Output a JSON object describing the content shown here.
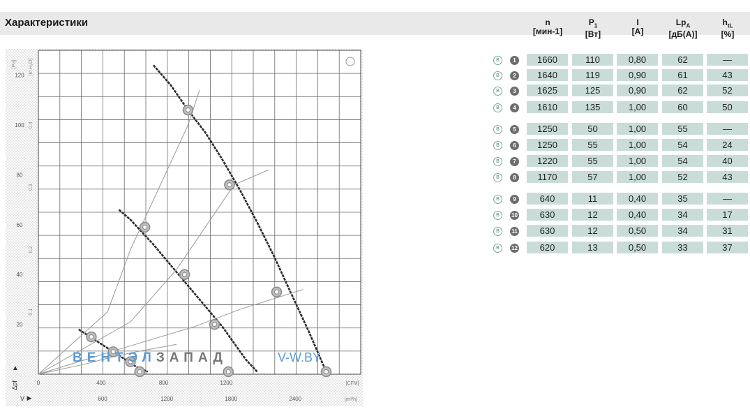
{
  "section": {
    "title": "Характеристики"
  },
  "table": {
    "headers": [
      {
        "name": "n",
        "sub": "",
        "unit": "[мин-1]"
      },
      {
        "name": "P",
        "sub": "1",
        "unit": "[Вт]"
      },
      {
        "name": "I",
        "sub": "",
        "unit": "[A]"
      },
      {
        "name": "Lp",
        "sub": "A",
        "unit": "[дБ(A)]"
      },
      {
        "name": "h",
        "sub": "tL",
        "unit": "[%]"
      }
    ],
    "row_marker": "B",
    "rows": [
      {
        "id": "1",
        "n": "1660",
        "p1": "110",
        "i": "0,80",
        "lpa": "62",
        "htl": "—"
      },
      {
        "id": "2",
        "n": "1640",
        "p1": "119",
        "i": "0,90",
        "lpa": "61",
        "htl": "43"
      },
      {
        "id": "3",
        "n": "1625",
        "p1": "125",
        "i": "0,90",
        "lpa": "62",
        "htl": "52"
      },
      {
        "id": "4",
        "n": "1610",
        "p1": "135",
        "i": "1,00",
        "lpa": "60",
        "htl": "50"
      },
      {
        "id": "5",
        "n": "1250",
        "p1": "50",
        "i": "1,00",
        "lpa": "55",
        "htl": "—"
      },
      {
        "id": "6",
        "n": "1250",
        "p1": "55",
        "i": "1,00",
        "lpa": "54",
        "htl": "24"
      },
      {
        "id": "7",
        "n": "1220",
        "p1": "55",
        "i": "1,00",
        "lpa": "54",
        "htl": "40"
      },
      {
        "id": "8",
        "n": "1170",
        "p1": "57",
        "i": "1,00",
        "lpa": "52",
        "htl": "43"
      },
      {
        "id": "9",
        "n": "640",
        "p1": "11",
        "i": "0,40",
        "lpa": "35",
        "htl": "—"
      },
      {
        "id": "10",
        "n": "630",
        "p1": "12",
        "i": "0,40",
        "lpa": "34",
        "htl": "17"
      },
      {
        "id": "11",
        "n": "630",
        "p1": "12",
        "i": "0,50",
        "lpa": "34",
        "htl": "31"
      },
      {
        "id": "12",
        "n": "620",
        "p1": "13",
        "i": "0,50",
        "lpa": "33",
        "htl": "37"
      }
    ]
  },
  "watermark": {
    "part1": "ВЕНТЭЛ",
    "part2": "ЗАПАД",
    "part3": "V-W.BY"
  },
  "colors": {
    "cell_bg": "#c9dcd8",
    "curve": "#2b2b2b",
    "marker": "#a9a9a9",
    "watermark_blue": "#5b9bd5",
    "watermark_gray": "#777777",
    "chart_bg": "#e6e6e6"
  },
  "chart_data": {
    "type": "line",
    "xlabel": "[CFM]",
    "x2label": "[m³/h]",
    "ylabel": "[in H₂O]",
    "y2label": "[Pa]",
    "xlim": [
      0,
      2800
    ],
    "ylim": [
      0,
      130
    ],
    "x_ticks": [
      "0",
      "400",
      "800",
      "1200",
      "2400"
    ],
    "x2_ticks": [
      "600",
      "1200",
      "1800",
      "2400"
    ],
    "y_ticks": [
      "20",
      "40",
      "60",
      "80",
      "100",
      "120"
    ],
    "y2_ticks": [
      "0.1",
      "0.2",
      "0.3",
      "0.4"
    ],
    "grid": true,
    "series": [
      {
        "name": "",
        "style": "thick",
        "x": [
          1000,
          1150,
          1300,
          1450,
          1600,
          1750,
          1900,
          2050,
          2200,
          2350,
          2500
        ],
        "y": [
          124,
          116,
          106,
          97,
          86,
          74,
          61,
          47,
          32,
          17,
          1
        ]
      },
      {
        "name": "",
        "style": "thick",
        "x": [
          700,
          800,
          1000,
          1200,
          1400,
          1600,
          1800,
          1900
        ],
        "y": [
          66,
          62,
          52,
          41,
          30,
          19,
          6,
          1
        ]
      },
      {
        "name": "",
        "style": "thick",
        "x": [
          350,
          450,
          550,
          650,
          750,
          850,
          950
        ],
        "y": [
          18,
          15,
          12,
          9,
          6,
          3,
          1
        ]
      },
      {
        "name": "",
        "style": "thin",
        "x": [
          0,
          600,
          800,
          1300,
          1400
        ],
        "y": [
          0,
          25,
          50,
          100,
          114
        ]
      },
      {
        "name": "",
        "style": "thin",
        "x": [
          0,
          800,
          1200,
          1700,
          2000
        ],
        "y": [
          0,
          21,
          42,
          76,
          82
        ]
      },
      {
        "name": "",
        "style": "thin",
        "x": [
          0,
          700,
          1350,
          1750,
          2300
        ],
        "y": [
          0,
          10,
          19,
          26,
          34
        ]
      },
      {
        "name": "",
        "style": "thin",
        "x": [
          0,
          400,
          650,
          850,
          1200
        ],
        "y": [
          0,
          4,
          7,
          9,
          12
        ]
      }
    ],
    "points": [
      {
        "x": 1300,
        "y": 106
      },
      {
        "x": 1660,
        "y": 76
      },
      {
        "x": 2070,
        "y": 33
      },
      {
        "x": 2500,
        "y": 1
      },
      {
        "x": 925,
        "y": 59
      },
      {
        "x": 1270,
        "y": 40
      },
      {
        "x": 1530,
        "y": 20
      },
      {
        "x": 1650,
        "y": 1
      },
      {
        "x": 460,
        "y": 15
      },
      {
        "x": 650,
        "y": 9
      },
      {
        "x": 800,
        "y": 5
      },
      {
        "x": 880,
        "y": 1
      }
    ]
  }
}
